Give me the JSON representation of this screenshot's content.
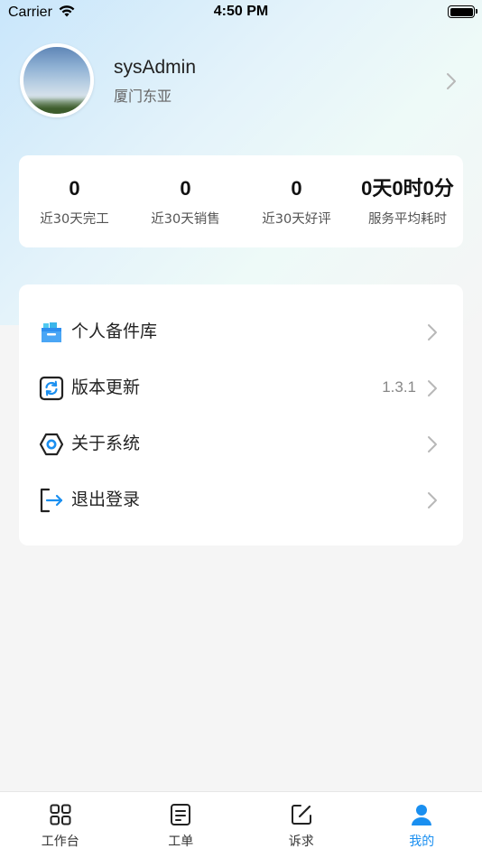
{
  "status_bar": {
    "carrier": "Carrier",
    "time": "4:50 PM"
  },
  "profile": {
    "username": "sysAdmin",
    "location": "厦门东亚"
  },
  "stats": [
    {
      "value": "0",
      "label": "近30天完工"
    },
    {
      "value": "0",
      "label": "近30天销售"
    },
    {
      "value": "0",
      "label": "近30天好评"
    },
    {
      "value": "0天0时0分",
      "label": "服务平均耗时"
    }
  ],
  "menu": [
    {
      "label": "个人备件库",
      "value": "",
      "icon": "folder-icon"
    },
    {
      "label": "版本更新",
      "value": "1.3.1",
      "icon": "refresh-icon"
    },
    {
      "label": "关于系统",
      "value": "",
      "icon": "hexagon-icon"
    },
    {
      "label": "退出登录",
      "value": "",
      "icon": "logout-icon"
    }
  ],
  "tabs": [
    {
      "label": "工作台",
      "icon": "grid-icon",
      "active": false
    },
    {
      "label": "工单",
      "icon": "document-icon",
      "active": false
    },
    {
      "label": "诉求",
      "icon": "edit-icon",
      "active": false
    },
    {
      "label": "我的",
      "icon": "user-icon",
      "active": true
    }
  ],
  "colors": {
    "accent": "#1a8ff0",
    "background": "#f5f5f5",
    "card": "#ffffff"
  }
}
